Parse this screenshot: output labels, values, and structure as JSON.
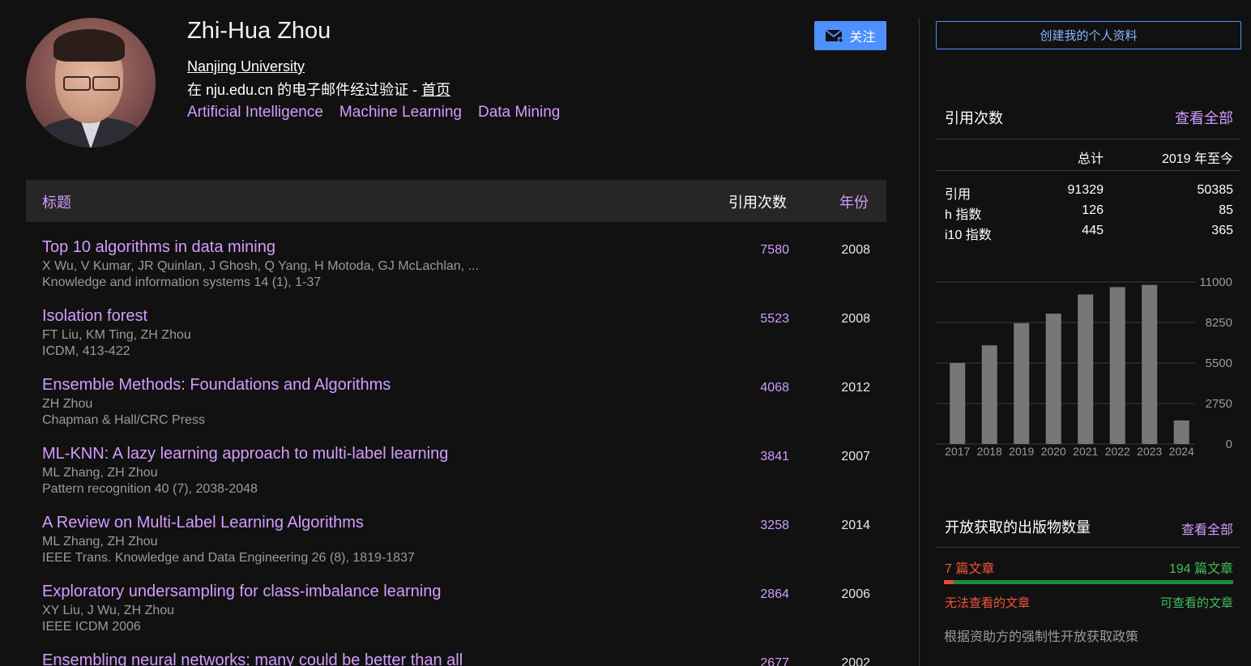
{
  "profile": {
    "name": "Zhi-Hua Zhou",
    "affiliation": "Nanjing University",
    "verified_prefix": "在 nju.edu.cn 的电子邮件经过验证 - ",
    "homepage_label": "首页",
    "interests": [
      "Artificial Intelligence",
      "Machine Learning",
      "Data Mining"
    ],
    "follow_label": "关注"
  },
  "table": {
    "col_title": "标题",
    "col_cited": "引用次数",
    "col_year": "年份",
    "rows": [
      {
        "title": "Top 10 algorithms in data mining",
        "authors": "X Wu, V Kumar, JR Quinlan, J Ghosh, Q Yang, H Motoda, GJ McLachlan, ...",
        "venue": "Knowledge and information systems 14 (1), 1-37",
        "cited": "7580",
        "year": "2008"
      },
      {
        "title": "Isolation forest",
        "authors": "FT Liu, KM Ting, ZH Zhou",
        "venue": "ICDM, 413-422",
        "cited": "5523",
        "year": "2008"
      },
      {
        "title": "Ensemble Methods: Foundations and Algorithms",
        "authors": "ZH Zhou",
        "venue": "Chapman & Hall/CRC Press",
        "cited": "4068",
        "year": "2012"
      },
      {
        "title": "ML-KNN: A lazy learning approach to multi-label learning",
        "authors": "ML Zhang, ZH Zhou",
        "venue": "Pattern recognition 40 (7), 2038-2048",
        "cited": "3841",
        "year": "2007"
      },
      {
        "title": "A Review on Multi-Label Learning Algorithms",
        "authors": "ML Zhang, ZH Zhou",
        "venue": "IEEE Trans. Knowledge and Data Engineering 26 (8), 1819-1837",
        "cited": "3258",
        "year": "2014"
      },
      {
        "title": "Exploratory undersampling for class-imbalance learning",
        "authors": "XY Liu, J Wu, ZH Zhou",
        "venue": "IEEE ICDM 2006",
        "cited": "2864",
        "year": "2006"
      },
      {
        "title": "Ensembling neural networks: many could be better than all",
        "authors": "",
        "venue": "",
        "cited": "2677",
        "year": "2002"
      }
    ]
  },
  "sidebar": {
    "create_profile": "创建我的个人资料",
    "citations_heading": "引用次数",
    "view_all": "查看全部",
    "col_total": "总计",
    "col_since": "2019 年至今",
    "stats": [
      {
        "label": "引用",
        "total": "91329",
        "since": "50385"
      },
      {
        "label": "h 指数",
        "total": "126",
        "since": "85"
      },
      {
        "label": "i10 指数",
        "total": "445",
        "since": "365"
      }
    ],
    "oa_heading": "开放获取的出版物数量",
    "oa_view_all": "查看全部",
    "oa_unavailable_count": "7 篇文章",
    "oa_available_count": "194 篇文章",
    "oa_unavailable_label": "无法查看的文章",
    "oa_available_label": "可查看的文章",
    "oa_unavailable_fraction": 0.035,
    "policy_text": "根据资助方的强制性开放获取政策",
    "colors": {
      "accent": "#d49cff",
      "button": "#4d90fe",
      "red": "#f2553d",
      "green": "#3fbf5f",
      "bar": "#777777"
    }
  },
  "chart_data": {
    "type": "bar",
    "categories": [
      "2017",
      "2018",
      "2019",
      "2020",
      "2021",
      "2022",
      "2023",
      "2024"
    ],
    "values": [
      5500,
      6700,
      8200,
      8850,
      10150,
      10650,
      10800,
      1600
    ],
    "ylim": [
      0,
      11000
    ],
    "yticks": [
      "11000",
      "8250",
      "5500",
      "2750",
      "0"
    ],
    "ytick_values": [
      11000,
      8250,
      5500,
      2750,
      0
    ],
    "grid": true
  }
}
